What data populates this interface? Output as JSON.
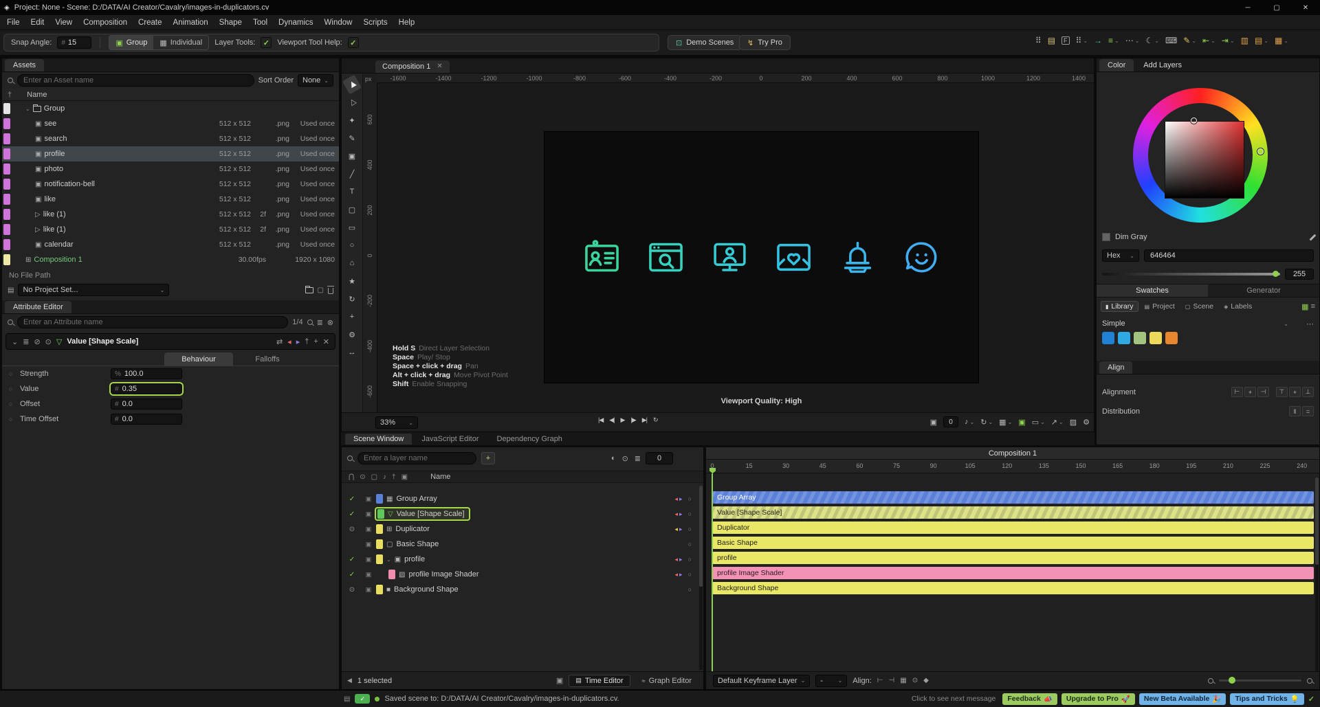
{
  "window": {
    "title": "Project: None - Scene: D:/DATA/AI Creator/Cavalry/images-in-duplicators.cv"
  },
  "menu": {
    "items": [
      "File",
      "Edit",
      "View",
      "Composition",
      "Create",
      "Animation",
      "Shape",
      "Tool",
      "Dynamics",
      "Window",
      "Scripts",
      "Help"
    ]
  },
  "toolbar": {
    "snap_angle_label": "Snap Angle:",
    "snap_angle_value": "15",
    "group_label": "Group",
    "individual_label": "Individual",
    "layer_tools_label": "Layer Tools:",
    "viewport_tool_help_label": "Viewport Tool Help:",
    "demo_scenes_label": "Demo Scenes",
    "try_pro_label": "Try Pro",
    "right_icons": [
      {
        "name": "apps-grid-icon",
        "glyph": "⠿",
        "color": "#b9b9b9",
        "caret": false
      },
      {
        "name": "panel-layout-icon",
        "glyph": "▤",
        "color": "#d8c07a",
        "caret": false
      },
      {
        "name": "focus-f-icon",
        "glyph": "F",
        "color": "#b9b9b9",
        "boxed": true,
        "caret": false
      },
      {
        "name": "workspace-icon",
        "glyph": "⠿",
        "color": "#b9b9b9",
        "caret": true
      },
      {
        "name": "import-arrow-icon",
        "glyph": "→",
        "color": "#59c1a6",
        "caret": false
      },
      {
        "name": "snapping-icon",
        "glyph": "≡",
        "color": "#8fd14f",
        "caret": true
      },
      {
        "name": "more-dots-icon",
        "glyph": "⋯",
        "color": "#b9b9b9",
        "caret": true
      },
      {
        "name": "dark-mode-icon",
        "glyph": "☾",
        "color": "#b9b9b9",
        "caret": true
      },
      {
        "name": "shortcuts-icon",
        "glyph": "⌨",
        "color": "#b9b9b9",
        "caret": false
      },
      {
        "name": "annotate-pen-icon",
        "glyph": "✎",
        "color": "#e3c35a",
        "caret": true
      },
      {
        "name": "align-row-icon",
        "glyph": "⇤",
        "color": "#8fd14f",
        "caret": true
      },
      {
        "name": "align-column-icon",
        "glyph": "⇥",
        "color": "#8fd14f",
        "caret": true
      },
      {
        "name": "columns-view-icon",
        "glyph": "▥",
        "color": "#e0a04a",
        "caret": false
      },
      {
        "name": "rows-view-icon",
        "glyph": "▤",
        "color": "#e0a04a",
        "caret": true
      },
      {
        "name": "grid-view-icon",
        "glyph": "▦",
        "color": "#e0a04a",
        "caret": true
      }
    ]
  },
  "assets": {
    "tab": "Assets",
    "search_placeholder": "Enter an Asset name",
    "sort_label": "Sort Order",
    "sort_value": "None",
    "name_header": "Name",
    "rows": [
      {
        "name": "Group",
        "kind": "folder",
        "chip": "#e4e4e4",
        "indent": 1
      },
      {
        "name": "see",
        "kind": "image",
        "chip": "#cf74da",
        "size": "512 x 512",
        "frames": "",
        "ext": ".png",
        "usage": "Used once",
        "indent": 2
      },
      {
        "name": "search",
        "kind": "image",
        "chip": "#cf74da",
        "size": "512 x 512",
        "frames": "",
        "ext": ".png",
        "usage": "Used once",
        "indent": 2
      },
      {
        "name": "profile",
        "kind": "image",
        "chip": "#cf74da",
        "size": "512 x 512",
        "frames": "",
        "ext": ".png",
        "usage": "Used once",
        "indent": 2,
        "selected": true
      },
      {
        "name": "photo",
        "kind": "image",
        "chip": "#cf74da",
        "size": "512 x 512",
        "frames": "",
        "ext": ".png",
        "usage": "Used once",
        "indent": 2
      },
      {
        "name": "notification-bell",
        "kind": "image",
        "chip": "#cf74da",
        "size": "512 x 512",
        "frames": "",
        "ext": ".png",
        "usage": "Used once",
        "indent": 2
      },
      {
        "name": "like",
        "kind": "image",
        "chip": "#cf74da",
        "size": "512 x 512",
        "frames": "",
        "ext": ".png",
        "usage": "Used once",
        "indent": 2
      },
      {
        "name": "like (1)",
        "kind": "video",
        "chip": "#cf74da",
        "size": "512 x 512",
        "frames": "2f",
        "ext": ".png",
        "usage": "Used once",
        "indent": 2
      },
      {
        "name": "like (1)",
        "kind": "video",
        "chip": "#cf74da",
        "size": "512 x 512",
        "frames": "2f",
        "ext": ".png",
        "usage": "Used once",
        "indent": 2
      },
      {
        "name": "calendar",
        "kind": "image",
        "chip": "#cf74da",
        "size": "512 x 512",
        "frames": "",
        "ext": ".png",
        "usage": "Used once",
        "indent": 2
      },
      {
        "name": "Composition 1",
        "kind": "comp",
        "chip": "#efe9a8",
        "fps": "30.00fps",
        "dims": "1920 x 1080",
        "indent": 1,
        "green": true
      }
    ]
  },
  "project": {
    "no_file_label": "No File Path",
    "project_value": "No Project Set..."
  },
  "attribute_editor": {
    "tab": "Attribute Editor",
    "search_placeholder": "Enter an Attribute name",
    "counter": "1/4",
    "header_title": "Value [Shape Scale]",
    "header_left_icons": [
      {
        "name": "collapse-icon",
        "glyph": "⌄",
        "color": "#9a9a9a"
      },
      {
        "name": "list-icon",
        "glyph": "≣",
        "color": "#9a9a9a"
      },
      {
        "name": "enabled-icon",
        "glyph": "⊘",
        "color": "#9a9a9a"
      },
      {
        "name": "target-icon",
        "glyph": "⊙",
        "color": "#9a9a9a"
      },
      {
        "name": "value-type-icon",
        "glyph": "▽",
        "color": "#6fcf5f"
      }
    ],
    "header_right_icons": [
      {
        "name": "swap-icon",
        "glyph": "⇄",
        "color": "#9a9a9a"
      },
      {
        "name": "prev-attribute-icon",
        "glyph": "◂",
        "color": "#e06a6a"
      },
      {
        "name": "next-attribute-icon",
        "glyph": "▸",
        "color": "#8e7ae8"
      },
      {
        "name": "pin-icon",
        "glyph": "†",
        "color": "#9a9a9a"
      },
      {
        "name": "add-icon",
        "glyph": "+",
        "color": "#9a9a9a"
      },
      {
        "name": "close-icon",
        "glyph": "✕",
        "color": "#9a9a9a"
      }
    ],
    "tabs": [
      {
        "label": "Behaviour",
        "active": true
      },
      {
        "label": "Falloffs",
        "active": false
      }
    ],
    "rows": [
      {
        "label": "Strength",
        "prefix": "%",
        "value": "100.0",
        "highlight": false
      },
      {
        "label": "Value",
        "prefix": "#",
        "value": "0.35",
        "highlight": true
      },
      {
        "label": "Offset",
        "prefix": "#",
        "value": "0.0",
        "highlight": false
      },
      {
        "label": "Time Offset",
        "prefix": "#",
        "value": "0.0",
        "highlight": false
      }
    ]
  },
  "tools": {
    "items": [
      {
        "name": "select-tool",
        "glyph": "▶",
        "rot": -120,
        "active": true
      },
      {
        "name": "direct-select-tool",
        "glyph": "▷",
        "rot": -120
      },
      {
        "name": "grab-tool",
        "glyph": "✦"
      },
      {
        "name": "knife-tool",
        "glyph": "✎"
      },
      {
        "name": "camera-tool",
        "glyph": "▣"
      },
      {
        "name": "line-tool",
        "glyph": "╱"
      },
      {
        "name": "text-tool",
        "glyph": "T"
      },
      {
        "name": "artboard-tool",
        "glyph": "▢"
      },
      {
        "name": "rectangle-tool",
        "glyph": "▭"
      },
      {
        "name": "ellipse-tool",
        "glyph": "○"
      },
      {
        "name": "polygon-tool",
        "glyph": "⌂"
      },
      {
        "name": "star-tool",
        "glyph": "★"
      },
      {
        "name": "spiral-tool",
        "glyph": "↻"
      },
      {
        "name": "anchor-tool",
        "glyph": "+"
      },
      {
        "name": "null-tool",
        "glyph": "⚙"
      },
      {
        "name": "motion-tool",
        "glyph": "↔"
      }
    ],
    "more": "»"
  },
  "viewport": {
    "tab": "Composition 1",
    "ruler_unit": "px",
    "h_ruler": [
      "-1600",
      "-1400",
      "-1200",
      "-1000",
      "-800",
      "-600",
      "-400",
      "-200",
      "0",
      "200",
      "400",
      "600",
      "800",
      "1000",
      "1200",
      "1400"
    ],
    "v_ruler": [
      "600",
      "400",
      "200",
      "0",
      "-200",
      "-400",
      "-600"
    ],
    "canvas_icons": [
      {
        "name": "contact-card-icon",
        "color": "#3bd49c"
      },
      {
        "name": "browser-search-icon",
        "color": "#36d2bd"
      },
      {
        "name": "user-monitor-icon",
        "color": "#34cbd2"
      },
      {
        "name": "photo-heart-icon",
        "color": "#35c1e0"
      },
      {
        "name": "notification-bell-icon",
        "color": "#3ab6ea"
      },
      {
        "name": "chat-smiley-icon",
        "color": "#42adf2"
      }
    ],
    "hints": [
      {
        "key": "Hold S",
        "desc": "Direct Layer Selection"
      },
      {
        "key": "Space",
        "desc": "Play/ Stop"
      },
      {
        "key": "Space + click + drag",
        "desc": "Pan"
      },
      {
        "key": "Alt + click + drag",
        "desc": "Move Pivot Point"
      },
      {
        "key": "Shift",
        "desc": "Enable Snapping"
      }
    ],
    "quality_label": "Viewport Quality: High",
    "zoom_value": "33%",
    "camera_count": "0",
    "transport": [
      {
        "name": "go-to-start-button",
        "glyph": "|◀"
      },
      {
        "name": "previous-frame-button",
        "glyph": "◀|"
      },
      {
        "name": "play-button",
        "glyph": "▶"
      },
      {
        "name": "next-frame-button",
        "glyph": "|▶"
      },
      {
        "name": "go-to-end-button",
        "glyph": "▶|"
      },
      {
        "name": "loop-button",
        "glyph": "↻"
      }
    ],
    "right_icons": [
      {
        "name": "snapshot-camera-icon",
        "glyph": "▣",
        "color": "#b5b5b5",
        "caret": false,
        "count_after": true
      },
      {
        "name": "audio-icon",
        "glyph": "♪",
        "color": "#b5b5b5",
        "caret": true
      },
      {
        "name": "refresh-viewport-icon",
        "glyph": "↻",
        "color": "#b5b5b5",
        "caret": true
      },
      {
        "name": "grid-overlay-icon",
        "glyph": "▦",
        "color": "#b5b5b5",
        "caret": true
      },
      {
        "name": "display-quality-icon",
        "glyph": "▣",
        "color": "#8fd14f",
        "caret": false
      },
      {
        "name": "screen-bounds-icon",
        "glyph": "▭",
        "color": "#b5b5b5",
        "caret": true
      },
      {
        "name": "export-frame-icon",
        "glyph": "↗",
        "color": "#b5b5b5",
        "caret": true
      },
      {
        "name": "transparency-icon",
        "glyph": "▨",
        "color": "#b5b5b5",
        "caret": false
      },
      {
        "name": "viewport-settings-gear-icon",
        "glyph": "⚙",
        "color": "#b5b5b5",
        "caret": false
      }
    ]
  },
  "scene_tabs": [
    {
      "label": "Scene Window",
      "active": true
    },
    {
      "label": "JavaScript Editor",
      "active": false
    },
    {
      "label": "Dependency Graph",
      "active": false
    }
  ],
  "layers": {
    "search_placeholder": "Enter a layer name",
    "frame_value": "0",
    "name_header": "Name",
    "toolbar_icons": [
      {
        "name": "isolate-icon",
        "glyph": "◐"
      },
      {
        "name": "solo-icon",
        "glyph": "⊙"
      },
      {
        "name": "filter-settings-icon",
        "glyph": "≣"
      }
    ],
    "header_icons": [
      {
        "name": "lock-column-icon",
        "glyph": "⋂"
      },
      {
        "name": "visibility-column-icon",
        "glyph": "⊙"
      },
      {
        "name": "matte-column-icon",
        "glyph": "▢"
      },
      {
        "name": "audio-column-icon",
        "glyph": "♪"
      },
      {
        "name": "pin-column-icon",
        "glyph": "†"
      },
      {
        "name": "render-column-icon",
        "glyph": "▣"
      }
    ],
    "rows": [
      {
        "name": "Group Array",
        "chip": "#5b80da",
        "left": "check",
        "icon": "▦",
        "indent": 0,
        "flags": [
          {
            "glyph": "◂",
            "color": "#e06a6a"
          },
          {
            "glyph": "▸",
            "color": "#8e7ae8"
          }
        ]
      },
      {
        "name": "Value [Shape Scale]",
        "chip": "#5ec95a",
        "left": "check",
        "icon": "▽",
        "icon_color": "#6fcf5f",
        "indent": 0,
        "selected": true,
        "flags": [
          {
            "glyph": "◂",
            "color": "#e06a6a"
          },
          {
            "glyph": "▸",
            "color": "#8e7ae8"
          }
        ]
      },
      {
        "name": "Duplicator",
        "chip": "#e8df5e",
        "left": "eye",
        "icon": "⊞",
        "indent": 0,
        "flags": [
          {
            "glyph": "◂",
            "color": "#e8c94a"
          },
          {
            "glyph": "▸",
            "color": "#8e7ae8"
          }
        ]
      },
      {
        "name": "Basic Shape",
        "chip": "#e8df5e",
        "left": "none",
        "icon": "▢",
        "indent": 0,
        "flags": []
      },
      {
        "name": "profile",
        "chip": "#e8df5e",
        "left": "check",
        "icon": "▣",
        "indent": 0,
        "expand": true,
        "flags": [
          {
            "glyph": "◂",
            "color": "#e06a6a"
          },
          {
            "glyph": "▸",
            "color": "#8e7ae8"
          }
        ]
      },
      {
        "name": "profile Image Shader",
        "chip": "#f08cb0",
        "left": "check",
        "icon": "▨",
        "indent": 1,
        "flags": [
          {
            "glyph": "◂",
            "color": "#e06a6a"
          },
          {
            "glyph": "▸",
            "color": "#8e7ae8"
          }
        ]
      },
      {
        "name": "Background Shape",
        "chip": "#e8df5e",
        "left": "eye",
        "icon": "■",
        "indent": 0,
        "flags": []
      }
    ],
    "footer": {
      "selected_label": "1 selected",
      "time_editor_label": "Time Editor",
      "graph_editor_label": "Graph Editor"
    }
  },
  "timeline": {
    "comp_label": "Composition 1",
    "ruler": [
      "0",
      "15",
      "30",
      "45",
      "60",
      "75",
      "90",
      "105",
      "120",
      "135",
      "150",
      "165",
      "180",
      "195",
      "210",
      "225",
      "240"
    ],
    "tracks": [
      {
        "name": "Group Array",
        "color": "#5b80da",
        "stripe": "light",
        "text": "#ffffff"
      },
      {
        "name": "Value [Shape Scale]",
        "color": "#dde289",
        "stripe": "dark",
        "text": "#20231a"
      },
      {
        "name": "Duplicator",
        "color": "#eae766",
        "stripe": "",
        "text": "#20231a"
      },
      {
        "name": "Basic Shape",
        "color": "#eae766",
        "stripe": "",
        "text": "#20231a"
      },
      {
        "name": "profile",
        "color": "#eae766",
        "stripe": "",
        "text": "#20231a"
      },
      {
        "name": "profile Image Shader",
        "color": "#f392b4",
        "stripe": "",
        "text": "#2a1a20"
      },
      {
        "name": "Background Shape",
        "color": "#eae766",
        "stripe": "",
        "text": "#20231a"
      }
    ],
    "footer": {
      "keyframe_layer_label": "Default Keyframe Layer",
      "secondary_value": "-",
      "align_label": "Align:",
      "icons": [
        {
          "name": "align-start-icon",
          "glyph": "⊢"
        },
        {
          "name": "align-end-icon",
          "glyph": "⊣"
        },
        {
          "name": "snap-grid-icon",
          "glyph": "▦"
        },
        {
          "name": "visibility-icon",
          "glyph": "⊙"
        },
        {
          "name": "keyframe-icon",
          "glyph": "◆"
        }
      ]
    }
  },
  "color_panel": {
    "tabs": [
      {
        "label": "Color",
        "active": true
      },
      {
        "label": "Add Layers",
        "active": false
      }
    ],
    "color_name": "Dim Gray",
    "hex_label": "Hex",
    "hex_value": "646464",
    "alpha_value": "255",
    "swatch_tabs": [
      {
        "label": "Swatches",
        "active": true
      },
      {
        "label": "Generator",
        "active": false
      }
    ],
    "library_tabs": [
      {
        "label": "Library",
        "glyph": "▮",
        "active": true
      },
      {
        "label": "Project",
        "glyph": "▤",
        "active": false
      },
      {
        "label": "Scene",
        "glyph": "▢",
        "active": false
      },
      {
        "label": "Labels",
        "glyph": "◈",
        "active": false
      }
    ],
    "group_label": "Simple",
    "swatches": [
      "#1f82d6",
      "#2fa9e2",
      "#a3c47f",
      "#ecd95c",
      "#e8872e"
    ]
  },
  "align_panel": {
    "tab": "Align",
    "alignment_label": "Alignment",
    "distribution_label": "Distribution",
    "alignment_buttons": [
      {
        "name": "align-left-button",
        "glyph": "⊢"
      },
      {
        "name": "align-center-h-button",
        "glyph": "+"
      },
      {
        "name": "align-right-button",
        "glyph": "⊣"
      },
      {
        "name": "align-top-button",
        "glyph": "⊤"
      },
      {
        "name": "align-center-v-button",
        "glyph": "+"
      },
      {
        "name": "align-bottom-button",
        "glyph": "⊥"
      }
    ],
    "distribution_buttons": [
      {
        "name": "distribute-horizontal-button",
        "glyph": "‖"
      },
      {
        "name": "distribute-vertical-button",
        "glyph": "="
      }
    ]
  },
  "status": {
    "message": "Saved scene to: D:/DATA/AI Creator/Cavalry/images-in-duplicators.cv.",
    "next_message_label": "Click to see next message",
    "buttons": [
      {
        "label": "Feedback",
        "emoji": "📣",
        "bg": "#9ccc5f",
        "fg": "#1c2b12"
      },
      {
        "label": "Upgrade to Pro",
        "emoji": "🚀",
        "bg": "#9ccc5f",
        "fg": "#1c2b12"
      },
      {
        "label": "New Beta Available",
        "emoji": "🎉",
        "bg": "#6fb3e8",
        "fg": "#0f2438"
      },
      {
        "label": "Tips and Tricks",
        "emoji": "💡",
        "bg": "#6fb3e8",
        "fg": "#0f2438"
      }
    ]
  }
}
